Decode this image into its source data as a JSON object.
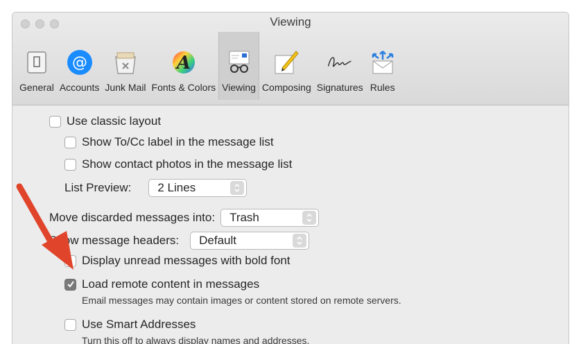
{
  "window": {
    "title": "Viewing"
  },
  "toolbar": {
    "items": [
      {
        "label": "General",
        "icon": "general-icon"
      },
      {
        "label": "Accounts",
        "icon": "accounts-icon"
      },
      {
        "label": "Junk Mail",
        "icon": "junk-mail-icon"
      },
      {
        "label": "Fonts & Colors",
        "icon": "fonts-colors-icon"
      },
      {
        "label": "Viewing",
        "icon": "viewing-icon",
        "selected": true
      },
      {
        "label": "Composing",
        "icon": "composing-icon"
      },
      {
        "label": "Signatures",
        "icon": "signatures-icon"
      },
      {
        "label": "Rules",
        "icon": "rules-icon"
      }
    ]
  },
  "settings": {
    "use_classic_layout": {
      "label": "Use classic layout",
      "checked": false
    },
    "show_tocc": {
      "label": "Show To/Cc label in the message list",
      "checked": false
    },
    "show_contact_photos": {
      "label": "Show contact photos in the message list",
      "checked": false
    },
    "list_preview": {
      "label": "List Preview:",
      "value": "2 Lines"
    },
    "move_discarded": {
      "label": "Move discarded messages into:",
      "value": "Trash"
    },
    "message_headers": {
      "label": "Show message headers:",
      "value": "Default"
    },
    "bold_unread": {
      "label": "Display unread messages with bold font",
      "checked": false
    },
    "load_remote": {
      "label": "Load remote content in messages",
      "checked": true,
      "description": "Email messages may contain images or content stored on remote servers."
    },
    "smart_addresses": {
      "label": "Use Smart Addresses",
      "checked": false,
      "description": "Turn this off to always display names and addresses."
    }
  },
  "colors": {
    "annotation_arrow": "#e0442a",
    "accounts_blue": "#1a8cff"
  }
}
